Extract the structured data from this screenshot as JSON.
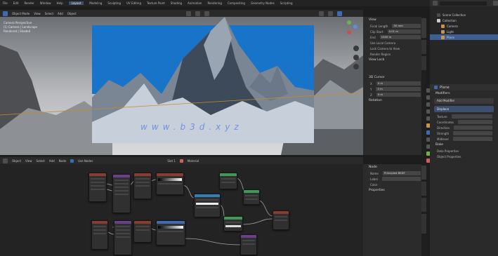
{
  "menu": {
    "items": [
      "File",
      "Edit",
      "Render",
      "Window",
      "Help",
      "Layout",
      "Modeling",
      "Sculpting",
      "UV Editing",
      "Texture Paint",
      "Shading",
      "Animation",
      "Rendering",
      "Compositing",
      "Geometry Nodes",
      "Scripting"
    ],
    "active_index": 5
  },
  "viewport": {
    "header_items": [
      "Object Mode",
      "View",
      "Select",
      "Add",
      "Object"
    ],
    "overlay_lines": [
      "Camera Perspective",
      "(1) Camera | Landscape",
      "Rendered | Shaded"
    ],
    "watermark_text": "www.b3d.xyz"
  },
  "view_panel": {
    "title": "View",
    "rows": [
      {
        "label": "Focal Length",
        "value": "50 mm"
      },
      {
        "label": "Clip Start",
        "value": "0.01 m"
      },
      {
        "label": "End",
        "value": "1000 m"
      }
    ],
    "checks": [
      "Use Local Camera",
      "Lock Camera to View",
      "Render Region"
    ],
    "sections": [
      "View Lock",
      "3D Cursor"
    ],
    "cursor_rows": [
      {
        "label": "X",
        "value": "0 m"
      },
      {
        "label": "Y",
        "value": "0 m"
      },
      {
        "label": "Z",
        "value": "0 m"
      }
    ],
    "rotation_label": "Rotation"
  },
  "outliner": {
    "search_placeholder": "",
    "items": [
      {
        "label": "Scene Collection",
        "selected": false
      },
      {
        "label": "Collection",
        "selected": false
      },
      {
        "label": "Camera",
        "selected": false
      },
      {
        "label": "Light",
        "selected": false
      },
      {
        "label": "Plane",
        "selected": true
      }
    ]
  },
  "properties": {
    "object_name": "Plane",
    "section": "Modifiers",
    "add_modifier_label": "Add Modifier",
    "subsection": "Displace",
    "rows": [
      "Texture",
      "Coordinates",
      "Direction",
      "Strength",
      "Midlevel"
    ],
    "status_text": "Bake",
    "footer_rows": [
      "Data Properties",
      "Object Properties"
    ]
  },
  "node_editor": {
    "header_items": [
      "Object",
      "View",
      "Select",
      "Add",
      "Node",
      "Use Nodes"
    ],
    "slot_label": "Slot 1",
    "material_label": "Material"
  },
  "node_side_panel": {
    "title": "Node",
    "name_label": "Name",
    "name_value": "Principled BSDF",
    "label_label": "Label",
    "color_label": "Color",
    "properties_label": "Properties"
  },
  "colors": {
    "accent": "#3f5e92",
    "sky": "#1b7fd0",
    "panel_bg": "#2b2b2b",
    "editor_bg": "#232323"
  }
}
